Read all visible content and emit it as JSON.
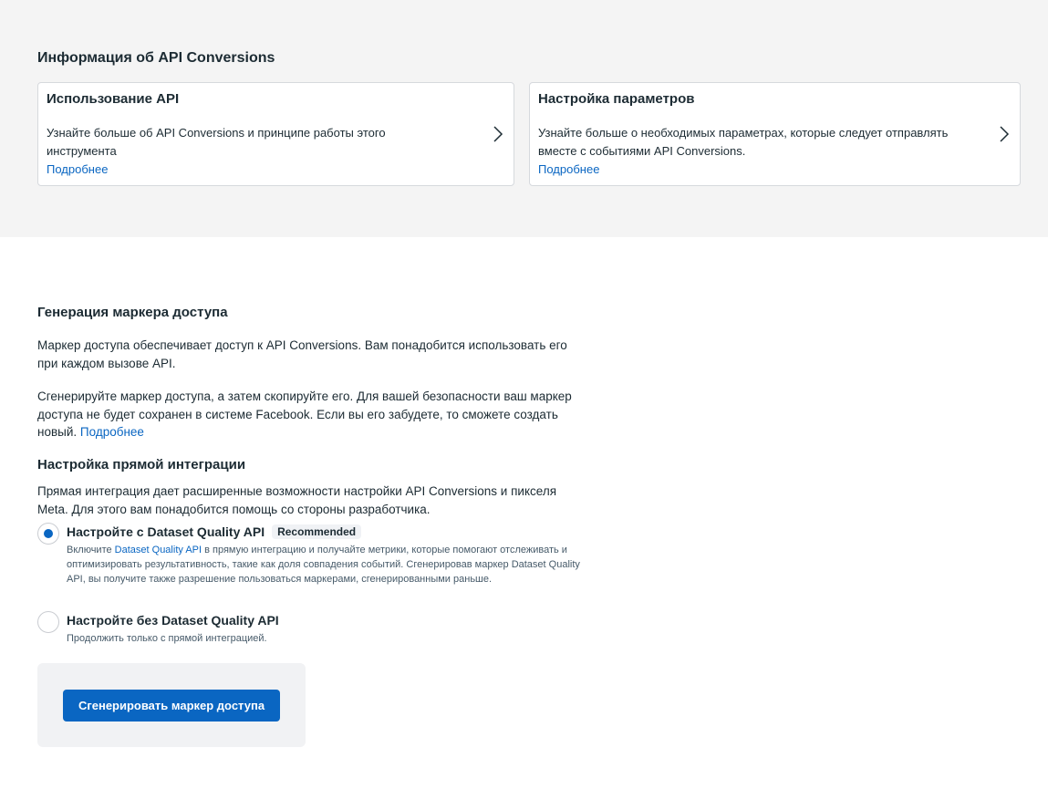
{
  "info_section": {
    "title": "Информация об API Conversions",
    "cards": [
      {
        "title": "Использование API",
        "description": "Узнайте больше об API Conversions и принципе работы этого инструмента",
        "link": "Подробнее"
      },
      {
        "title": "Настройка параметров",
        "description": "Узнайте больше о необходимых параметрах, которые следует отправлять вместе с событиями API Conversions.",
        "link": "Подробнее"
      }
    ]
  },
  "token_section": {
    "title": "Генерация маркера доступа",
    "para1": "Маркер доступа обеспечивает доступ к API Conversions. Вам понадобится использовать его при каждом вызове API.",
    "para2": "Сгенерируйте маркер доступа, а затем скопируйте его. Для вашей безопасности ваш маркер доступа не будет сохранен в системе Facebook. Если вы его забудете, то сможете создать новый.",
    "para2_link": "Подробнее"
  },
  "integration_section": {
    "title": "Настройка прямой интеграции",
    "description": "Прямая интеграция дает расширенные возможности настройки API Conversions и пикселя Meta. Для этого вам понадобится помощь со стороны разработчика.",
    "options": [
      {
        "label": "Настройте с Dataset Quality API",
        "badge": "Recommended",
        "selected": true,
        "desc_prefix": "Включите",
        "desc_link": "Dataset Quality API",
        "desc_suffix": "в прямую интеграцию и получайте метрики, которые помогают отслеживать и оптимизировать результативность, такие как доля совпадения событий. Сгенерировав маркер Dataset Quality API, вы получите также разрешение пользоваться маркерами, сгенерированными раньше."
      },
      {
        "label": "Настройте без Dataset Quality API",
        "selected": false,
        "description": "Продолжить только с прямой интеграцией."
      }
    ]
  },
  "generate_button": {
    "label": "Сгенерировать маркер доступа"
  },
  "colors": {
    "accent": "#0a66c2",
    "text": "#1c2b33",
    "gray_bg": "#f4f4f4"
  },
  "icons": {
    "card_arrow": "chevron-right-icon"
  }
}
